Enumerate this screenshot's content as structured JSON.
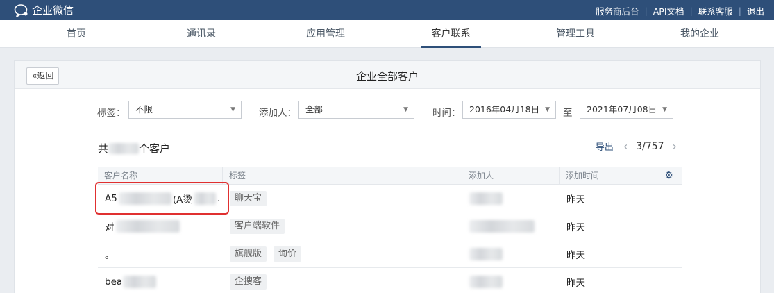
{
  "app": {
    "title": "企业微信"
  },
  "top_links": [
    "服务商后台",
    "API文档",
    "联系客服",
    "退出"
  ],
  "nav": {
    "tabs": [
      {
        "label": "首页"
      },
      {
        "label": "通讯录"
      },
      {
        "label": "应用管理"
      },
      {
        "label": "客户联系",
        "active": true
      },
      {
        "label": "管理工具"
      },
      {
        "label": "我的企业"
      }
    ]
  },
  "panel": {
    "back_label": "返回",
    "title": "企业全部客户"
  },
  "filters": {
    "tag_label": "标签：",
    "tag_value": "不限",
    "adder_label": "添加人：",
    "adder_value": "全部",
    "time_label": "时间：",
    "time_from": "2016年04月18日",
    "time_sep": "至",
    "time_to": "2021年07月08日"
  },
  "summary": {
    "prefix": "共",
    "suffix": "个客户"
  },
  "pager": {
    "export_label": "导出",
    "page": "3/757"
  },
  "table": {
    "headers": [
      "客户名称",
      "标签",
      "添加人",
      "添加时间"
    ],
    "rows": [
      {
        "name_start": "A5",
        "name_mid": "(A烫",
        "name_end": ".",
        "tags": [
          "聊天宝"
        ],
        "time": "昨天"
      },
      {
        "name_start": "对",
        "name_mid": "",
        "name_end": "",
        "tags": [
          "客户端软件"
        ],
        "time": "昨天"
      },
      {
        "name_start": "。",
        "name_mid": "",
        "name_end": "",
        "tags": [
          "旗舰版",
          "询价"
        ],
        "time": "昨天"
      },
      {
        "name_start": "bea",
        "name_mid": "",
        "name_end": "",
        "tags": [
          "企搜客"
        ],
        "time": "昨天"
      }
    ]
  },
  "colors": {
    "brand": "#2e4f79",
    "highlight": "#e03030"
  }
}
